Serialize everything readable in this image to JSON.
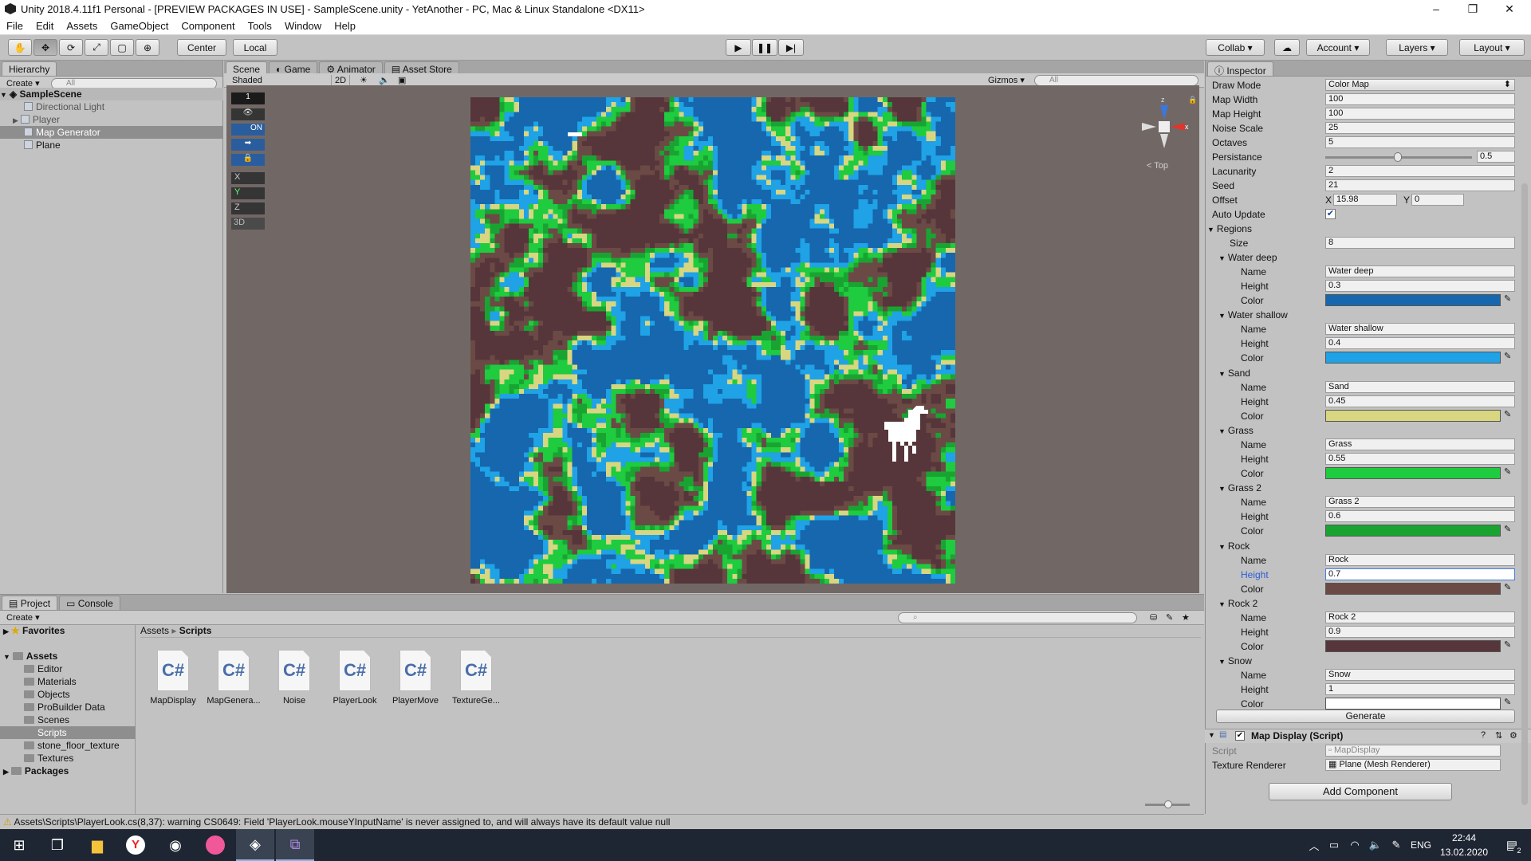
{
  "window": {
    "title": "Unity 2018.4.11f1 Personal - [PREVIEW PACKAGES IN USE] - SampleScene.unity - YetAnother - PC, Mac & Linux Standalone <DX11>",
    "minimize": "–",
    "maximize": "❐",
    "close": "✕"
  },
  "menu": [
    "File",
    "Edit",
    "Assets",
    "GameObject",
    "Component",
    "Tools",
    "Window",
    "Help"
  ],
  "toolbar": {
    "pivot": "Center",
    "space": "Local",
    "collab": "Collab ▾",
    "cloud": "☁",
    "account": "Account",
    "layers": "Layers",
    "layout": "Layout"
  },
  "hierarchy": {
    "tab": "Hierarchy",
    "create": "Create ▾",
    "search": "All",
    "scene": "SampleScene",
    "items": [
      "Directional Light",
      "Player",
      "Map Generator",
      "Plane"
    ]
  },
  "scene": {
    "tabs": [
      "Scene",
      "Game",
      "Animator",
      "Asset Store"
    ],
    "shading": "Shaded",
    "mode2d": "2D",
    "gizmos": "Gizmos ▾",
    "search": "All",
    "view_label": "< Top",
    "tools": [
      "1",
      "ON",
      "X",
      "Y",
      "Z",
      "3D"
    ]
  },
  "map": {
    "colors": {
      "water_deep": "#1667ad",
      "water_shallow": "#1fa2e6",
      "sand": "#d8d680",
      "grass": "#1fcb3f",
      "grass2": "#19a432",
      "rock": "#6b4a45",
      "rock2": "#56363a",
      "snow": "#ffffff"
    }
  },
  "inspector": {
    "tab": "Inspector",
    "fields": [
      {
        "label": "Draw Mode",
        "value": "Color Map"
      },
      {
        "label": "Map Width",
        "value": "100"
      },
      {
        "label": "Map Height",
        "value": "100"
      },
      {
        "label": "Noise Scale",
        "value": "25"
      },
      {
        "label": "Octaves",
        "value": "5"
      },
      {
        "label": "Persistance",
        "value": "0.5"
      },
      {
        "label": "Lacunarity",
        "value": "2"
      },
      {
        "label": "Seed",
        "value": "21"
      }
    ],
    "offset": {
      "label": "Offset",
      "x_label": "X",
      "x": "15.98",
      "y_label": "Y",
      "y": "0"
    },
    "auto_update": "Auto Update",
    "regions_label": "Regions",
    "size_label": "Size",
    "size": "8",
    "name_label": "Name",
    "height_label": "Height",
    "color_label": "Color",
    "regions": [
      {
        "title": "Water deep",
        "name": "Water deep",
        "height": "0.3",
        "color": "#1667ad"
      },
      {
        "title": "Water shallow",
        "name": "Water shallow",
        "height": "0.4",
        "color": "#1fa2e6"
      },
      {
        "title": "Sand",
        "name": "Sand",
        "height": "0.45",
        "color": "#d8d680"
      },
      {
        "title": "Grass",
        "name": "Grass",
        "height": "0.55",
        "color": "#1fcb3f"
      },
      {
        "title": "Grass 2",
        "name": "Grass 2",
        "height": "0.6",
        "color": "#19a432"
      },
      {
        "title": "Rock",
        "name": "Rock",
        "height": "0.7",
        "color": "#6b4a45"
      },
      {
        "title": "Rock 2",
        "name": "Rock 2",
        "height": "0.9",
        "color": "#56363a"
      },
      {
        "title": "Snow",
        "name": "Snow",
        "height": "1",
        "color": "#ffffff"
      }
    ],
    "generate": "Generate",
    "map_display": {
      "title": "Map Display (Script)",
      "script_label": "Script",
      "script": "MapDisplay",
      "renderer_label": "Texture Renderer",
      "renderer": "Plane (Mesh Renderer)"
    },
    "add_component": "Add Component"
  },
  "project": {
    "tabs": [
      "Project",
      "Console"
    ],
    "create": "Create ▾",
    "favorites": "Favorites",
    "assets": "Assets",
    "folders": [
      "Editor",
      "Materials",
      "Objects",
      "ProBuilder Data",
      "Scenes",
      "Scripts",
      "stone_floor_texture",
      "Textures"
    ],
    "packages": "Packages",
    "breadcrumb": [
      "Assets",
      "Scripts"
    ],
    "scripts": [
      "MapDisplay",
      "MapGenera...",
      "Noise",
      "PlayerLook",
      "PlayerMove",
      "TextureGe..."
    ],
    "script_glyph": "C#"
  },
  "status": "Assets\\Scripts\\PlayerLook.cs(8,37): warning CS0649: Field 'PlayerLook.mouseYInputName' is never assigned to, and will always have its default value null",
  "taskbar": {
    "lang": "ENG",
    "time": "22:44",
    "date": "13.02.2020",
    "notif": "2"
  }
}
